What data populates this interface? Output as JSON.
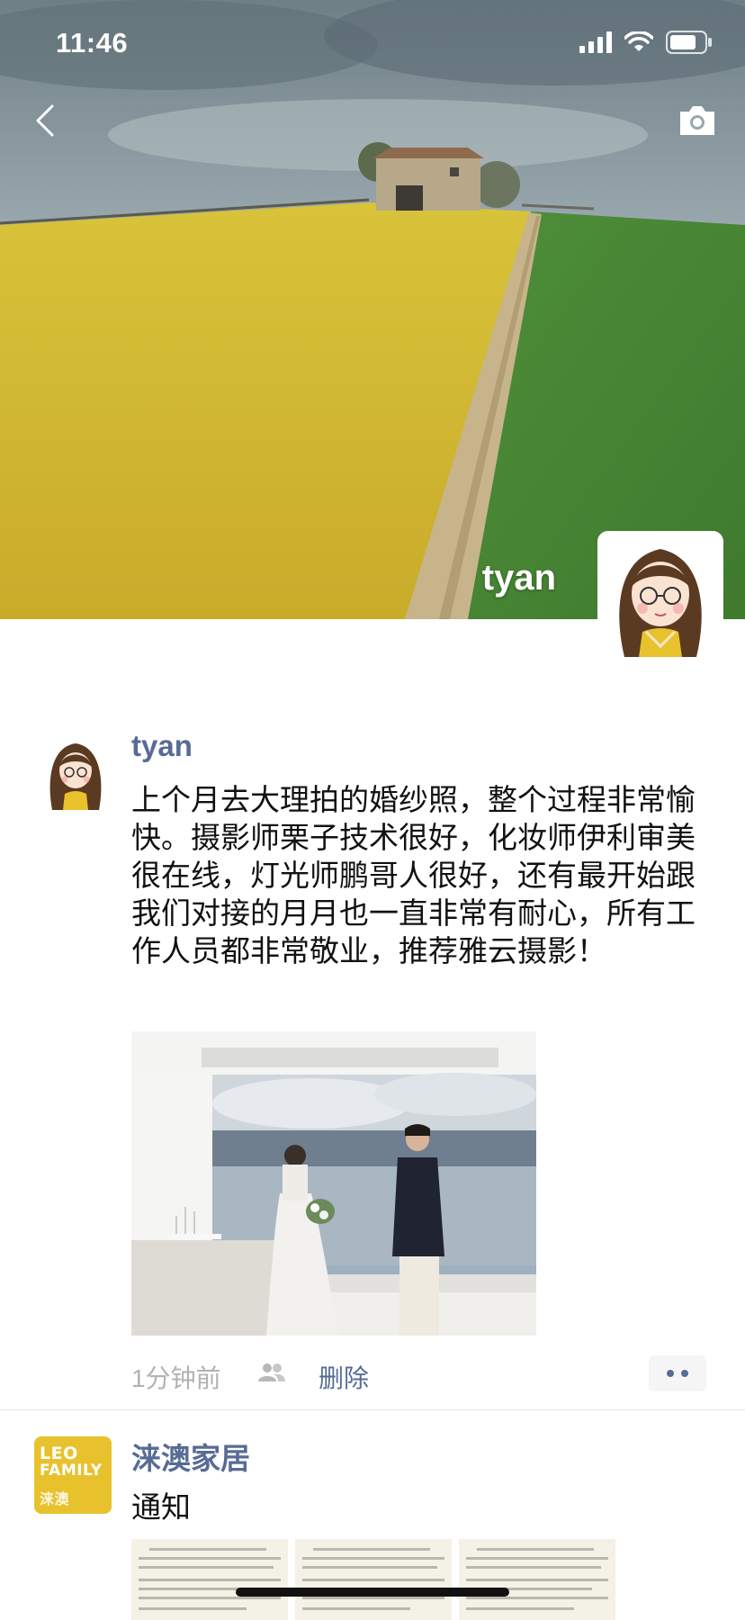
{
  "status_bar": {
    "time": "11:46",
    "icons": [
      "signal-icon",
      "wifi-icon",
      "battery-icon"
    ]
  },
  "nav": {
    "back_icon": "chevron-left-icon",
    "camera_icon": "camera-icon"
  },
  "cover": {
    "user_name": "tyan"
  },
  "posts": [
    {
      "author": "tyan",
      "text": "上个月去大理拍的婚纱照，整个过程非常愉快。摄影师栗子技术很好，化妆师伊利审美很在线，灯光师鹏哥人很好，还有最开始跟我们对接的月月也一直非常有耐心，所有工作人员都非常敬业，推荐雅云摄影！",
      "time": "1分钟前",
      "delete_label": "删除"
    },
    {
      "author": "涞澳家居",
      "text": "通知",
      "brand_logo": {
        "line1": "LEO",
        "line2": "FAMILY",
        "line3": "涞澳"
      }
    }
  ],
  "colors": {
    "link": "#576b95",
    "meta": "#b2b2b2",
    "brand": "#e8c22d"
  }
}
